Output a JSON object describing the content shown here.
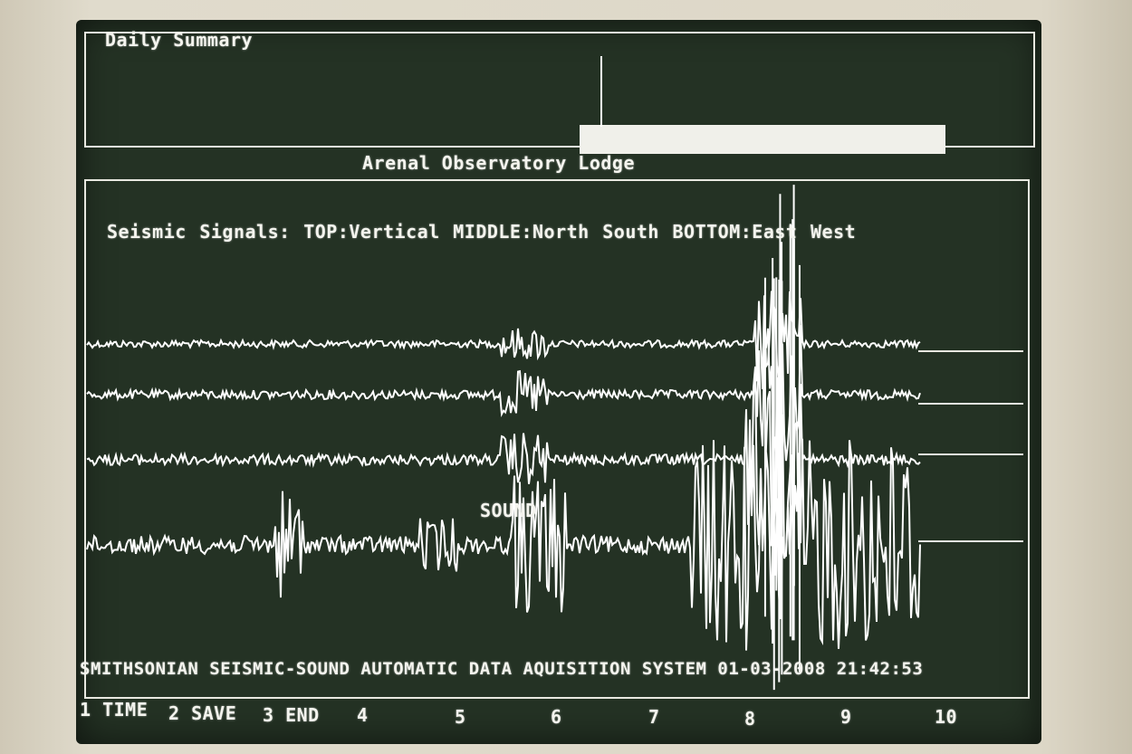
{
  "summary": {
    "title": "Daily Summary"
  },
  "station": {
    "name": "Arenal Observatory Lodge"
  },
  "signals": {
    "legend": "Seismic Signals: TOP:Vertical  MIDDLE:North South  BOTTOM:East West",
    "sound_label": "SOUND"
  },
  "footer": {
    "system": "SMITHSONIAN SEISMIC-SOUND AUTOMATIC DATA AQUISITION SYSTEM",
    "date": "01-03-2008",
    "time": "21:42:53"
  },
  "function_keys": [
    {
      "label": "1 TIME"
    },
    {
      "label": "2 SAVE"
    },
    {
      "label": "3 END"
    },
    {
      "label": "4"
    },
    {
      "label": "5"
    },
    {
      "label": "6"
    },
    {
      "label": "7"
    },
    {
      "label": "8"
    },
    {
      "label": "9"
    },
    {
      "label": "10"
    }
  ],
  "colors": {
    "screen": "#243224",
    "trace": "#ffffff"
  }
}
